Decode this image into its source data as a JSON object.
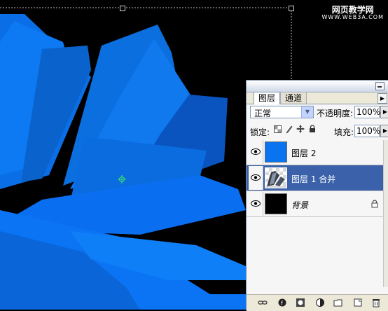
{
  "watermark": {
    "line1": "网页教学网",
    "line2": "WWW.WEB3A.COM"
  },
  "colors": {
    "canvas_bg": "#000000",
    "accent_blue": "#0a74f0",
    "selected_row": "#3a61a9",
    "background_layer": "#000000"
  },
  "layers_panel": {
    "tabs": [
      {
        "label": "图层"
      },
      {
        "label": "通道"
      }
    ],
    "blend_mode": "正常",
    "opacity_label": "不透明度:",
    "opacity_value": "100%",
    "lock_label": "锁定:",
    "fill_label": "填充:",
    "fill_value": "100%",
    "layers": [
      {
        "name": "图层 2",
        "thumbnail": "blue-fill",
        "visible_icon": "eye-icon",
        "selected": false
      },
      {
        "name": "图层 1 合并",
        "thumbnail": "crystal-shape",
        "visible_icon": "eye-icon",
        "selected": true
      },
      {
        "name": "背景",
        "thumbnail": "black-fill",
        "visible_icon": "eye-icon",
        "selected": false,
        "locked": true
      }
    ],
    "bottom_icons": [
      "link-icon",
      "layer-style-icon",
      "layer-mask-icon",
      "adjustment-layer-icon",
      "new-group-icon",
      "new-layer-icon",
      "delete-layer-icon"
    ]
  }
}
